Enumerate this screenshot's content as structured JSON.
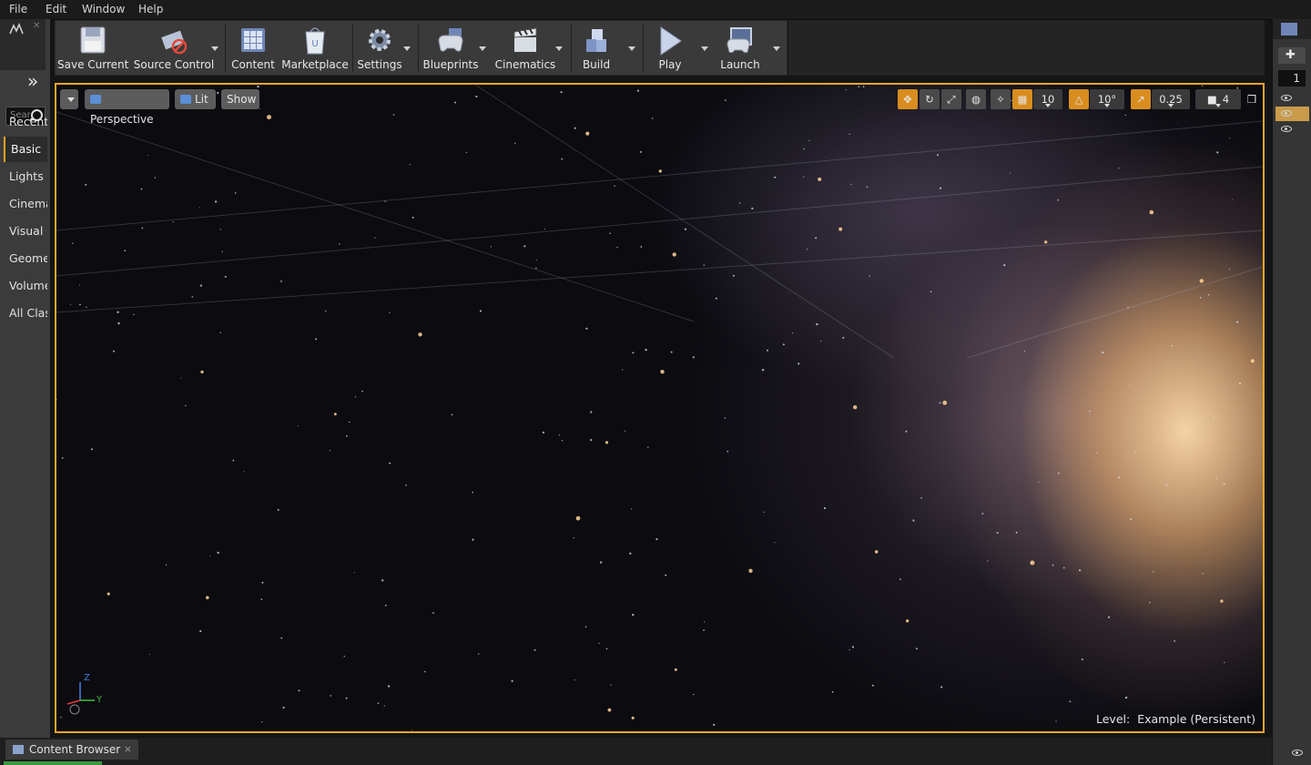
{
  "menu": [
    "File",
    "Edit",
    "Window",
    "Help"
  ],
  "modes": {
    "search_placeholder": "Search",
    "categories": [
      "Recently Placed",
      "Basic",
      "Lights",
      "Cinematic",
      "Visual Effects",
      "Geometry",
      "Volumes",
      "All Classes"
    ],
    "active_category": "Basic"
  },
  "toolbar": {
    "buttons": [
      {
        "label": "Save Current",
        "icon": "floppy-disk-icon"
      },
      {
        "label": "Source Control",
        "icon": "source-control-icon"
      },
      {
        "label": "Content",
        "icon": "content-grid-icon"
      },
      {
        "label": "Marketplace",
        "icon": "marketplace-bag-icon"
      },
      {
        "label": "Settings",
        "icon": "gear-icon"
      },
      {
        "label": "Blueprints",
        "icon": "gamepad-icon"
      },
      {
        "label": "Cinematics",
        "icon": "clapperboard-icon"
      },
      {
        "label": "Build",
        "icon": "build-blocks-icon"
      },
      {
        "label": "Play",
        "icon": "play-icon"
      },
      {
        "label": "Launch",
        "icon": "launch-icon"
      }
    ]
  },
  "viewport": {
    "perspective_label": "Perspective",
    "lit_label": "Lit",
    "show_label": "Show",
    "grid_snap": "10",
    "rotation_snap": "10°",
    "scale_snap": "0.25",
    "camera_speed": "4",
    "level_prefix": "Level:",
    "level_name": "Example (Persistent)",
    "axis": {
      "z": "Z",
      "y": "Y"
    }
  },
  "right_panel": {
    "layer_index": "1"
  },
  "bottom": {
    "content_browser_tab": "Content Browser",
    "close": "×"
  },
  "colors": {
    "accent": "#e6a72a",
    "panel": "#3a3a3a",
    "background": "#151515"
  }
}
